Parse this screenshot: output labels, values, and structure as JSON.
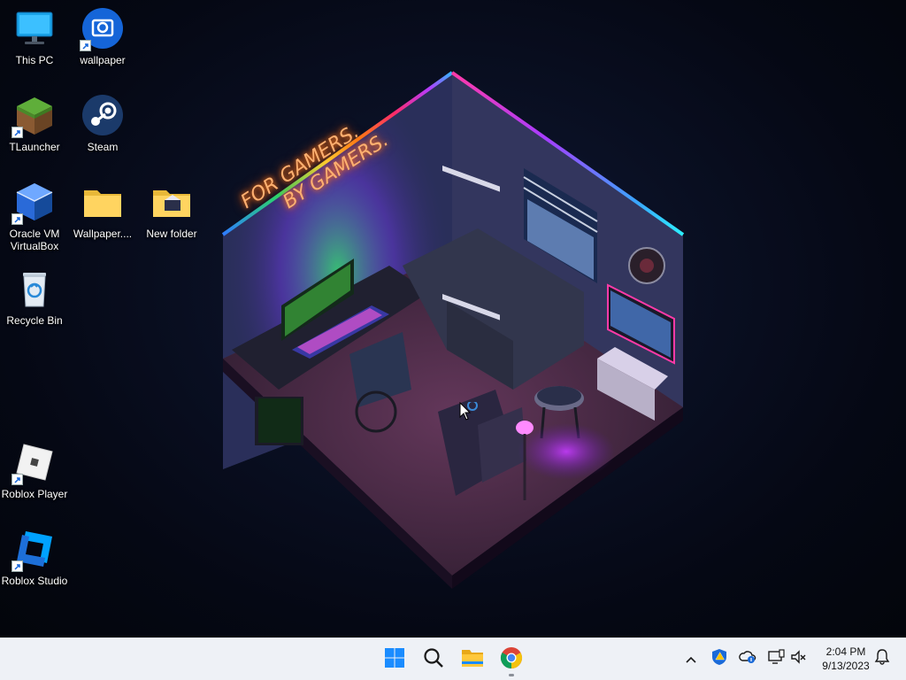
{
  "desktop": {
    "icons": [
      {
        "label": "This PC",
        "icon": "computer-monitor-icon"
      },
      {
        "label": "wallpaper",
        "icon": "wallpaper-engine-icon"
      },
      {
        "label": "TLauncher",
        "icon": "minecraft-grass-block-icon"
      },
      {
        "label": "Steam",
        "icon": "steam-icon"
      },
      {
        "label": "Oracle VM VirtualBox",
        "icon": "virtualbox-cube-icon"
      },
      {
        "label": "Wallpaper....",
        "icon": "folder-icon"
      },
      {
        "label": "New folder",
        "icon": "folder-icon"
      },
      {
        "label": "Recycle Bin",
        "icon": "recycle-bin-icon"
      },
      {
        "label": "Roblox Player",
        "icon": "roblox-player-icon"
      },
      {
        "label": "Roblox Studio",
        "icon": "roblox-studio-icon"
      }
    ],
    "wallpaper_text": [
      "FOR GAMERS.",
      "BY GAMERS."
    ]
  },
  "taskbar": {
    "pinned": [
      {
        "name": "start",
        "icon": "windows-start-icon"
      },
      {
        "name": "search",
        "icon": "search-icon"
      },
      {
        "name": "file-explorer",
        "icon": "folder-icon"
      },
      {
        "name": "chrome",
        "icon": "chrome-icon"
      }
    ],
    "tray": [
      "chevron-up-icon",
      "shield-warning-icon",
      "onedrive-cloud-icon",
      "network-icon",
      "speaker-muted-icon"
    ],
    "clock": {
      "time": "2:04 PM",
      "date": "9/13/2023"
    },
    "notification_icon": "bell-icon"
  },
  "colors": {
    "taskbar_bg": "#eef1f6",
    "windows_blue": "#1a8cff",
    "neon_orange": "#ff9a3c"
  }
}
